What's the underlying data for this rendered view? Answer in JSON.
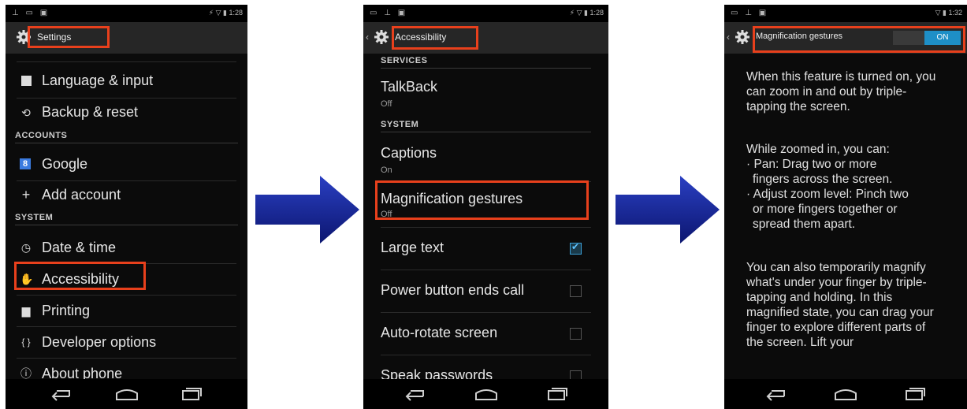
{
  "phone1": {
    "status_left": "⊥ ▭ ▣",
    "status_right": "⚡ ▽ ▮ 1:28",
    "title": "Settings",
    "items_top": [
      {
        "label": "Language & input",
        "icon": "keyboard-icon"
      },
      {
        "label": "Backup & reset",
        "icon": "restore-icon"
      }
    ],
    "section_accounts": "ACCOUNTS",
    "accounts": [
      {
        "label": "Google",
        "icon": "google-icon"
      },
      {
        "label": "Add account",
        "icon": "plus-icon"
      }
    ],
    "section_system": "SYSTEM",
    "system": [
      {
        "label": "Date & time",
        "icon": "clock-icon"
      },
      {
        "label": "Accessibility",
        "icon": "hand-icon"
      },
      {
        "label": "Printing",
        "icon": "printer-icon"
      },
      {
        "label": "Developer options",
        "icon": "braces-icon"
      },
      {
        "label": "About phone",
        "icon": "info-icon"
      }
    ]
  },
  "phone2": {
    "status_left": "▭ ⊥ ▣",
    "status_right": "⚡ ▽ ▮ 1:28",
    "title": "Accessibility",
    "section_services": "SERVICES",
    "talkback": {
      "label": "TalkBack",
      "sub": "Off"
    },
    "section_system": "SYSTEM",
    "captions": {
      "label": "Captions",
      "sub": "On"
    },
    "magnification": {
      "label": "Magnification gestures",
      "sub": "Off"
    },
    "toggles": [
      {
        "label": "Large text",
        "checked": true
      },
      {
        "label": "Power button ends call",
        "checked": false
      },
      {
        "label": "Auto-rotate screen",
        "checked": false
      },
      {
        "label": "Speak passwords",
        "checked": false
      }
    ]
  },
  "phone3": {
    "status_left": "▭ ⊥ ▣",
    "status_right": "▽ ▮ 1:32",
    "title": "Magnification gestures",
    "toggle_label": "ON",
    "para1": "When this feature is turned on, you can zoom in and out by triple-tapping the screen.",
    "para2_lines": [
      "While zoomed in, you can:",
      "· Pan: Drag two or more",
      "  fingers across the screen.",
      "· Adjust zoom level: Pinch two",
      "  or more fingers together or",
      "  spread them apart."
    ],
    "para3": "You can also temporarily magnify what's under your finger by triple-tapping and holding. In this magnified state, you can drag your finger to explore different parts of the screen. Lift your"
  },
  "colors": {
    "highlight": "#e8401c",
    "arrow": "#1a2a9c",
    "toggle_on": "#1e8fc7",
    "check": "#3aa0d8"
  }
}
